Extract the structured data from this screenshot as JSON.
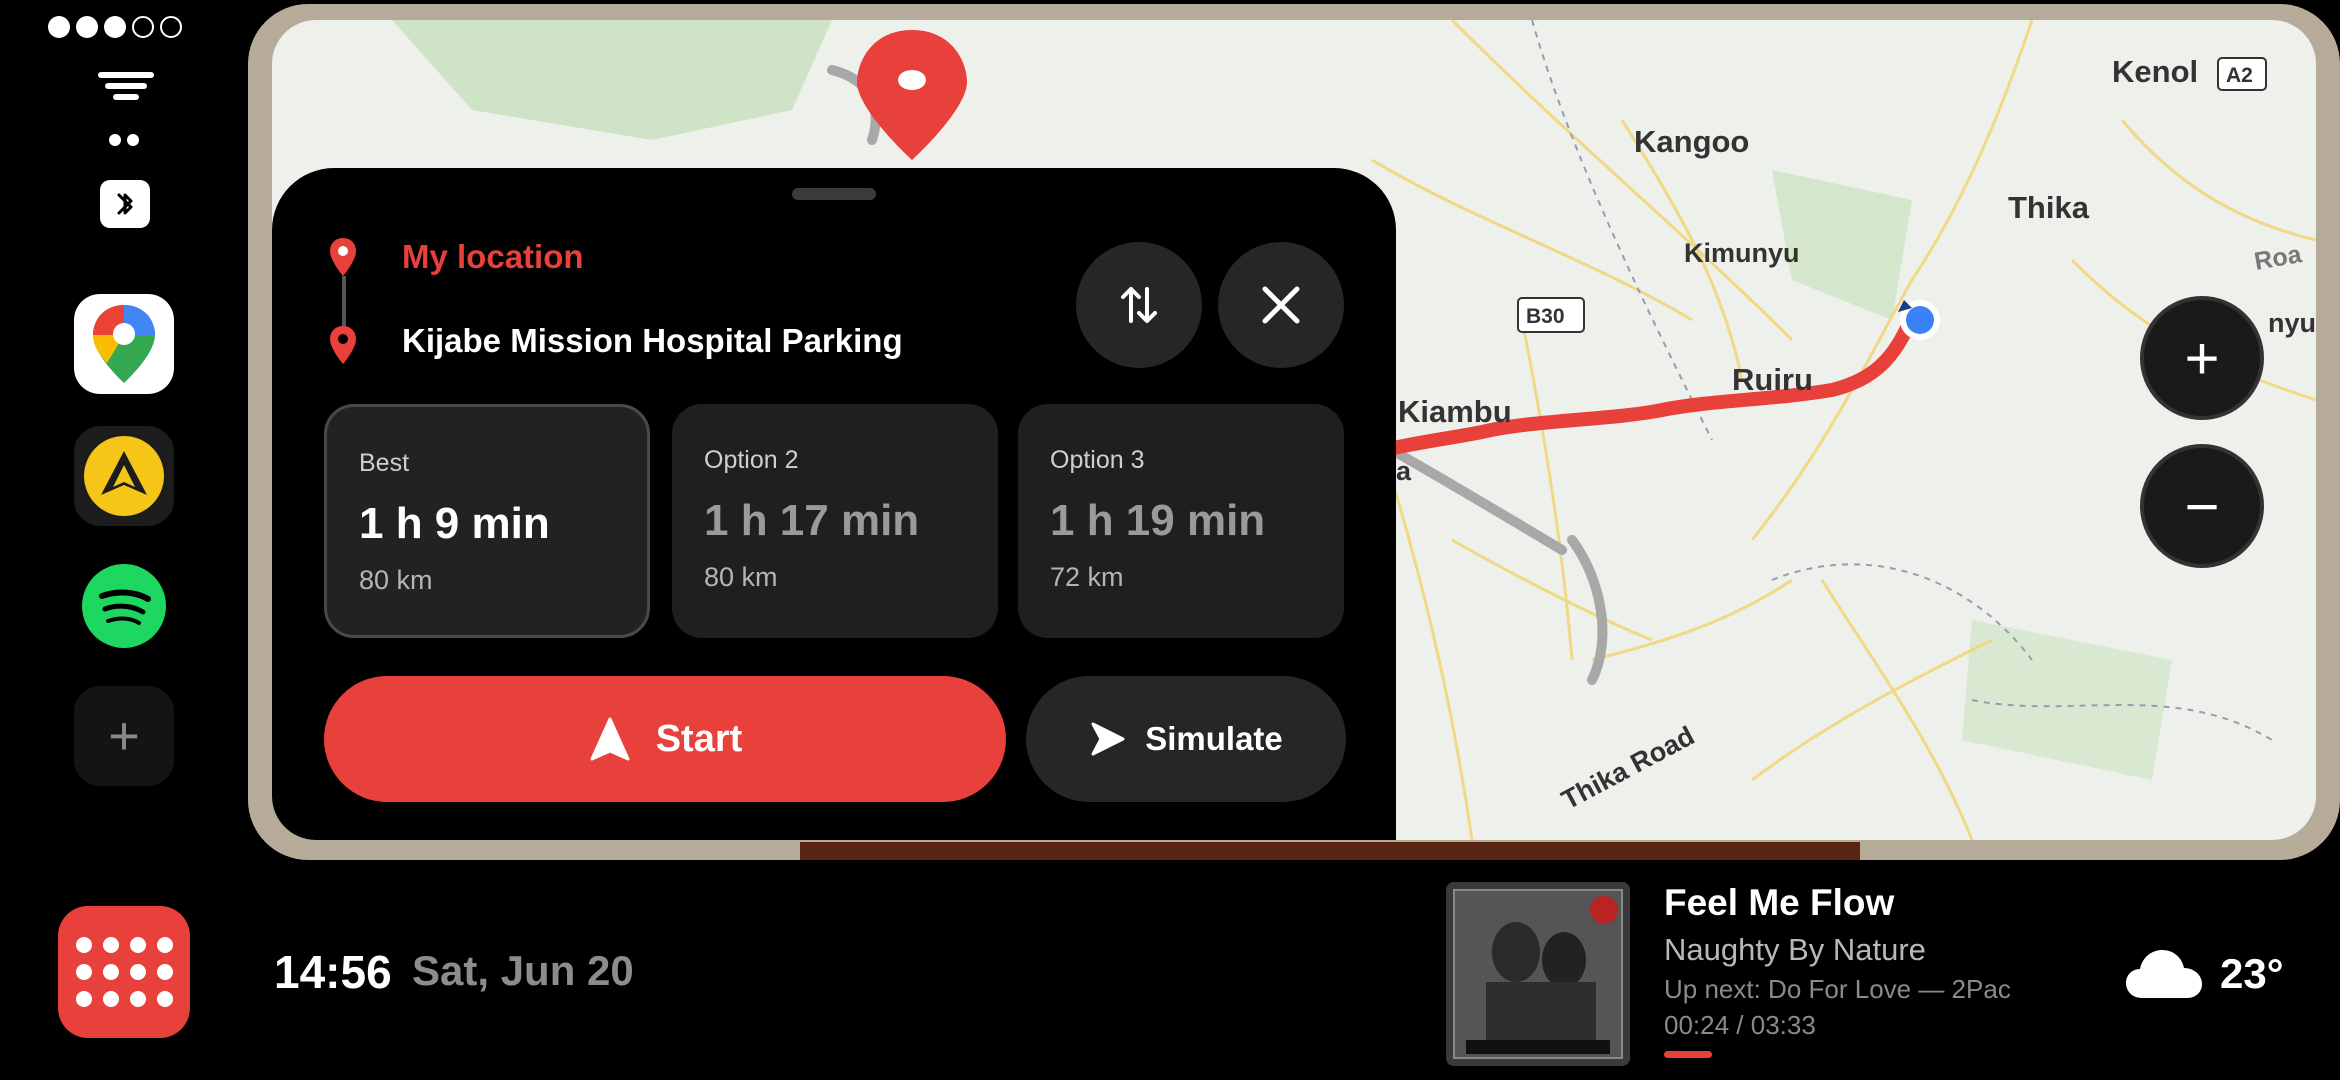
{
  "colors": {
    "accent": "#e8403a",
    "panel": "#000000",
    "card": "#1f1f1f",
    "route": "#e8403a",
    "current_location": "#3b82f6"
  },
  "dock": {
    "apps": [
      {
        "name": "maps-app-icon"
      },
      {
        "name": "aa-app-icon"
      },
      {
        "name": "spotify-app-icon"
      }
    ],
    "add_label": "+"
  },
  "map": {
    "labels": {
      "kenol": "Kenol",
      "a2": "A2",
      "kangoo": "Kangoo",
      "thika": "Thika",
      "kimunyu": "Kimunyu",
      "b30": "B30",
      "ruiru": "Ruiru",
      "kiambu": "Kiambu",
      "thika_road": "Thika Road",
      "roa": "Roa",
      "nyu": "nyu",
      "a_frag": "a"
    },
    "zoom_in": "+",
    "zoom_out": "−"
  },
  "route": {
    "from": "My location",
    "to": "Kijabe Mission Hospital Parking",
    "options": [
      {
        "label": "Best",
        "time": "1 h 9 min",
        "distance": "80 km"
      },
      {
        "label": "Option 2",
        "time": "1 h 17 min",
        "distance": "80 km"
      },
      {
        "label": "Option 3",
        "time": "1 h 19 min",
        "distance": "72 km"
      }
    ],
    "start_label": "Start",
    "simulate_label": "Simulate"
  },
  "status": {
    "time": "14:56",
    "date": "Sat, Jun 20"
  },
  "media": {
    "title": "Feel Me Flow",
    "artist": "Naughty By Nature",
    "up_next": "Up next: Do For Love — 2Pac",
    "progress_text": "00:24 / 03:33",
    "progress_fraction": 0.11
  },
  "weather": {
    "temperature": "23°",
    "icon": "cloud-icon"
  }
}
